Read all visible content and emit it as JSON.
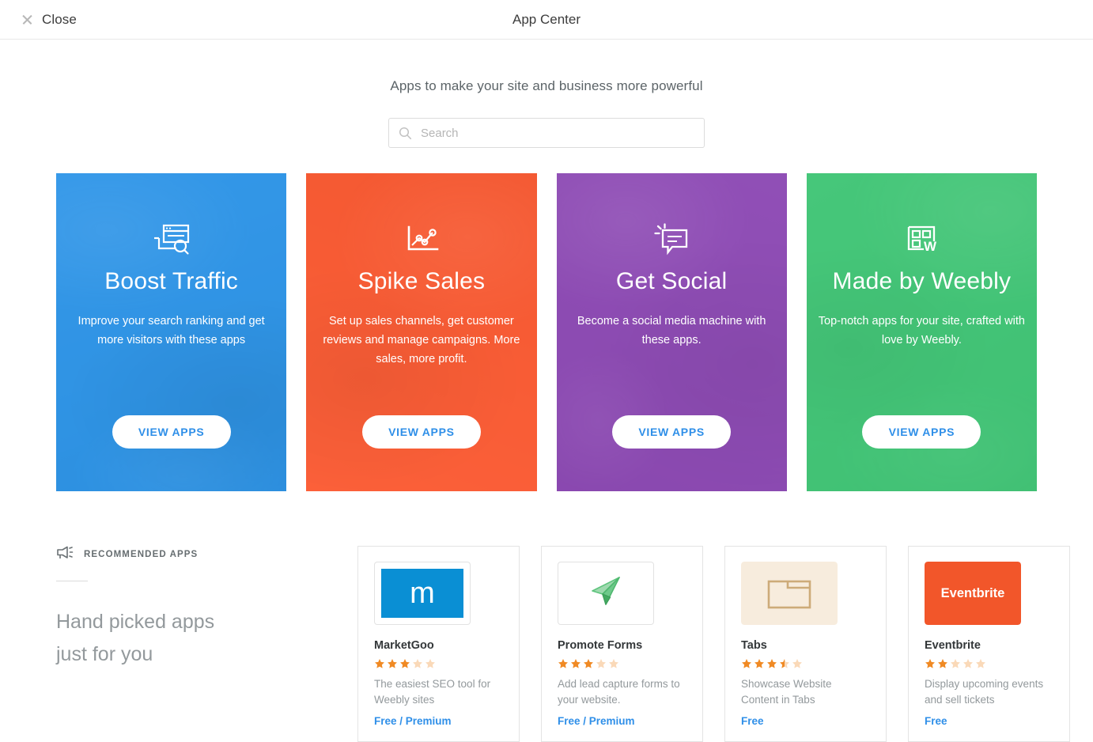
{
  "topbar": {
    "close_label": "Close",
    "title": "App Center",
    "close_icon": "close-icon"
  },
  "header": {
    "tagline": "Apps to make your site and business more powerful",
    "search_placeholder": "Search",
    "search_value": "",
    "search_icon": "search-icon"
  },
  "categories": [
    {
      "title": "Boost Traffic",
      "description": "Improve your search ranking and get more visitors with these apps",
      "button_label": "VIEW APPS",
      "color": "#2e95e8",
      "icon": "browser-search-icon"
    },
    {
      "title": "Spike Sales",
      "description": "Set up sales channels, get customer reviews and manage campaigns. More sales, more profit.",
      "button_label": "VIEW APPS",
      "color": "#fb5b33",
      "icon": "line-chart-icon"
    },
    {
      "title": "Get Social",
      "description": "Become a social media machine with these apps.",
      "button_label": "VIEW APPS",
      "color": "#8e4bb5",
      "icon": "speech-bubble-icon"
    },
    {
      "title": "Made by Weebly",
      "description": "Top-notch apps for your site, crafted with love by Weebly.",
      "button_label": "VIEW APPS",
      "color": "#42c677",
      "icon": "weebly-grid-icon"
    }
  ],
  "recommended": {
    "section_label": "RECOMMENDED APPS",
    "section_icon": "megaphone-icon",
    "tagline_line1": "Hand picked apps",
    "tagline_line2": "just for you",
    "apps": [
      {
        "name": "MarketGoo",
        "rating": 3,
        "description": "The easiest SEO tool for Weebly sites",
        "price": "Free / Premium",
        "thumb_kind": "marketgoo",
        "thumb_text": "m",
        "thumb_color": "#0a8fd4",
        "icon": "marketgoo-logo-icon"
      },
      {
        "name": "Promote Forms",
        "rating": 3,
        "description": "Add lead capture forms to your website.",
        "price": "Free / Premium",
        "thumb_kind": "plane",
        "thumb_text": "",
        "thumb_color": "#5ec47d",
        "icon": "paper-plane-icon"
      },
      {
        "name": "Tabs",
        "rating": 3.5,
        "description": "Showcase Website Content in Tabs",
        "price": "Free",
        "thumb_kind": "tabs",
        "thumb_text": "",
        "thumb_color": "#cdab79",
        "icon": "tabs-folder-icon"
      },
      {
        "name": "Eventbrite",
        "rating": 2,
        "description": "Display upcoming events and sell tickets",
        "price": "Free",
        "thumb_kind": "eventbrite",
        "thumb_text": "Eventbrite",
        "thumb_color": "#f2562a",
        "icon": "eventbrite-logo-icon"
      }
    ]
  },
  "colors": {
    "accent_blue": "#2f8fe8",
    "star_filled": "#f08a24",
    "star_empty": "#fad9b8"
  }
}
